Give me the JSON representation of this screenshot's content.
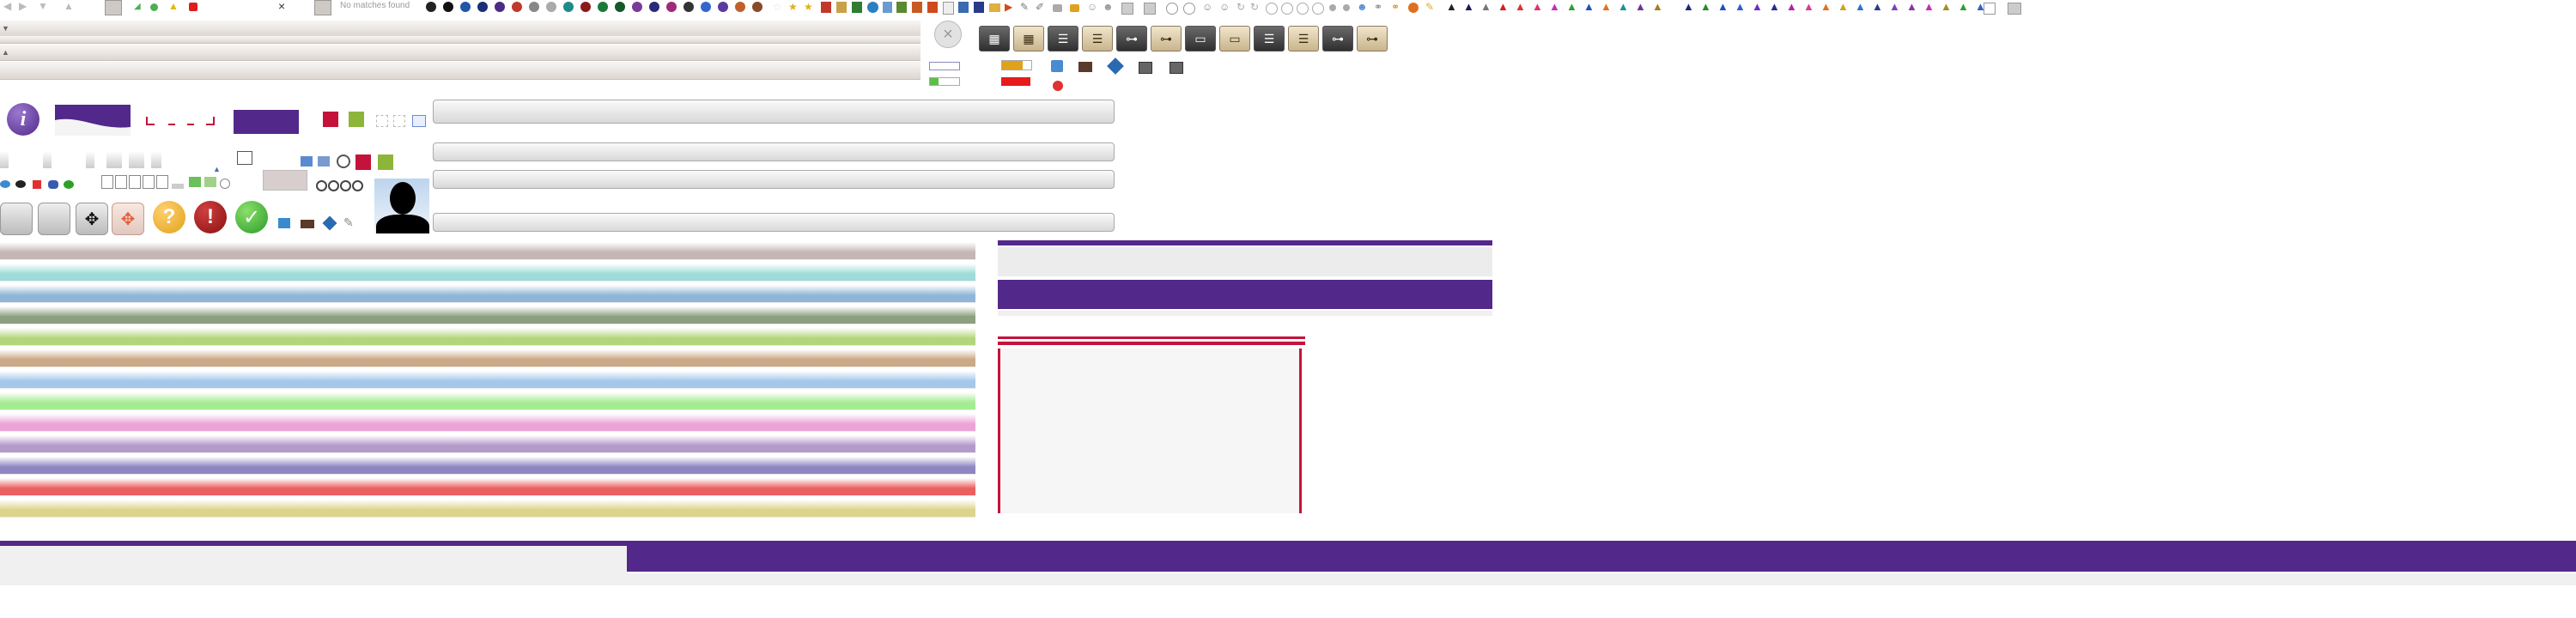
{
  "top_bar": {
    "no_matches_text": "No matches found",
    "close_glyph": "×"
  },
  "colors": {
    "purple": "#52288a",
    "crimson": "#c5123a",
    "green": "#8db53a",
    "amber": "#e0a21a",
    "red_bar": "#e71b1b"
  },
  "icons": {
    "info": "i",
    "question": "?",
    "warning": "!",
    "check": "✓"
  },
  "stripes": [
    {
      "color": "#c4b6b3"
    },
    {
      "color": "#9fdbd8"
    },
    {
      "color": "#8fb6d8"
    },
    {
      "color": "#8c9f7e"
    },
    {
      "color": "#b3d67c"
    },
    {
      "color": "#cba886"
    },
    {
      "color": "#a5c7ea"
    },
    {
      "color": "#a4ec93"
    },
    {
      "color": "#eca3d7"
    },
    {
      "color": "#b39acb"
    },
    {
      "color": "#8f86c1"
    },
    {
      "color": "#ea5f5f"
    },
    {
      "color": "#dcd48c"
    }
  ]
}
